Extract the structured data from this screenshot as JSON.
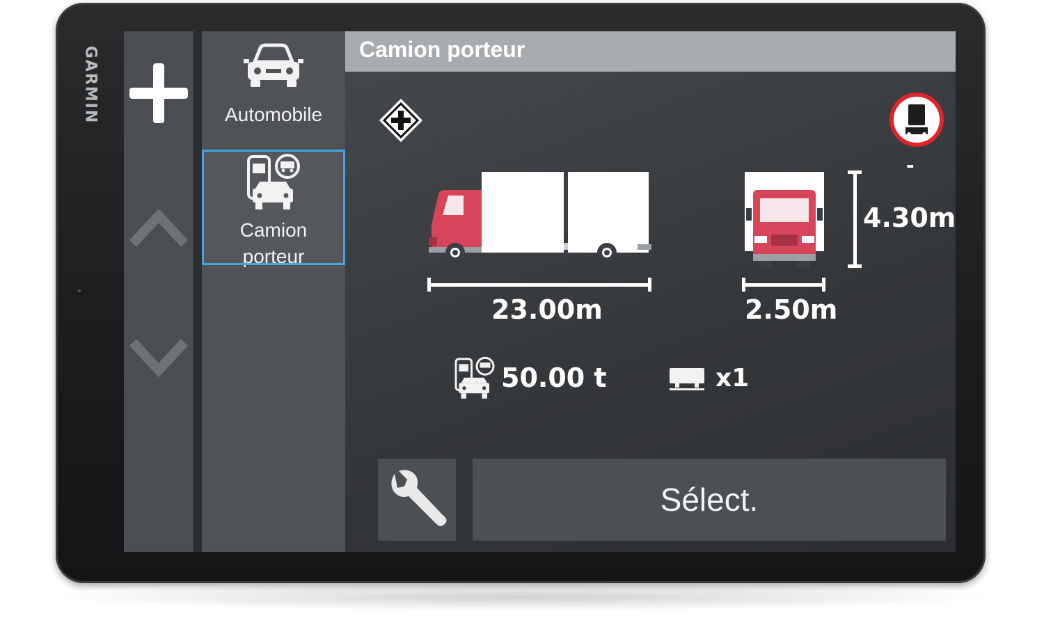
{
  "brand": "GARMIN",
  "rail": {
    "add_icon": "plus-icon",
    "up_icon": "chevron-up-icon",
    "down_icon": "chevron-down-icon"
  },
  "profiles": [
    {
      "label": "Automobile",
      "icon": "car-icon",
      "selected": false
    },
    {
      "label_line1": "Camion",
      "label_line2": "porteur",
      "icon": "truck-profile-icon",
      "selected": true
    }
  ],
  "main": {
    "title": "Camion porteur",
    "hazmat_icon": "hazmat-diamond-icon",
    "restriction_icon": "truck-restriction-sign-icon",
    "restriction_value": "-",
    "length": "23.00m",
    "width": "2.50m",
    "height": "4.30m",
    "weight": "50.00 t",
    "trailers": "x1",
    "colors": {
      "accent": "#43a7dd",
      "truck": "#d8445a",
      "sign_red": "#e0242b"
    }
  },
  "actions": {
    "settings_icon": "wrench-icon",
    "select_label": "Sélect."
  }
}
